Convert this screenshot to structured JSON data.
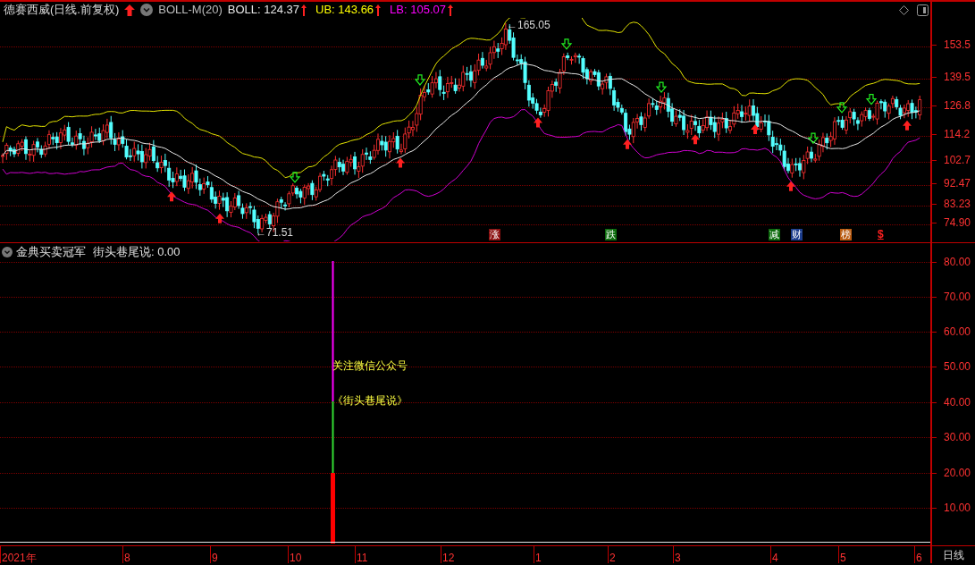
{
  "header": {
    "title": "德赛西威(日线.前复权)",
    "indicator_name": "BOLL-M(20)",
    "indicators": [
      {
        "label": "BOLL: 124.37",
        "color": "#e8e8e8"
      },
      {
        "label": "UB: 143.66",
        "color": "#ffff00"
      },
      {
        "label": "LB: 105.07",
        "color": "#ff00ff"
      }
    ]
  },
  "price_axis": [
    "153.5",
    "139.5",
    "126.8",
    "114.2",
    "102.7",
    "92.47",
    "83.23",
    "74.90"
  ],
  "annotations": [
    {
      "text": "←165.05",
      "kind": "high"
    },
    {
      "text": "←71.51",
      "kind": "low"
    }
  ],
  "markers": [
    {
      "label": "涨",
      "color": "#8b1010",
      "kind": "badge"
    },
    {
      "label": "跌",
      "color": "#0d6b0d",
      "kind": "badge"
    },
    {
      "label": "减",
      "color": "#0d6b0d",
      "kind": "badge"
    },
    {
      "label": "财",
      "color": "#1c3d8c",
      "kind": "badge"
    },
    {
      "label": "榜",
      "color": "#b85a10",
      "kind": "badge"
    },
    {
      "label": "$",
      "color": "#ff2020",
      "kind": "glyph"
    }
  ],
  "lower_panel": {
    "title": "金典买卖冠军",
    "value": "街头巷尾说: 0.00",
    "notes": [
      "关注微信公众号",
      "《街头巷尾说》"
    ],
    "axis": [
      "80.00",
      "70.00",
      "60.00",
      "50.00",
      "40.00",
      "30.00",
      "20.00",
      "10.00"
    ]
  },
  "time_axis": [
    "2021年",
    "8",
    "9",
    "10",
    "11",
    "12",
    "1",
    "2",
    "3",
    "4",
    "5",
    "6"
  ],
  "period": "日线"
}
